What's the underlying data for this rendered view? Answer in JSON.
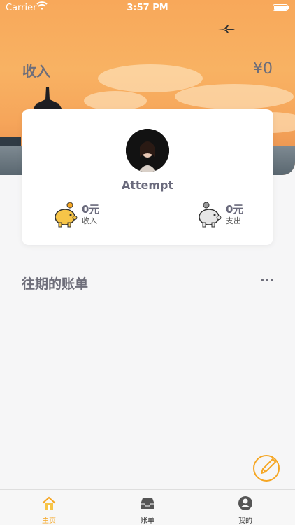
{
  "status_bar": {
    "carrier": "Carrier",
    "time": "3:57 PM"
  },
  "hero": {
    "income_label": "收入",
    "income_value": "¥0"
  },
  "profile": {
    "username": "Attempt"
  },
  "stats": [
    {
      "amount": "0元",
      "label": "收入",
      "icon": "piggy-bank-gold-icon"
    },
    {
      "amount": "0元",
      "label": "支出",
      "icon": "piggy-bank-gray-icon"
    }
  ],
  "history": {
    "title": "往期的账单"
  },
  "tabbar": {
    "items": [
      {
        "label": "主页",
        "icon": "home-icon",
        "active": true
      },
      {
        "label": "账单",
        "icon": "inbox-icon",
        "active": false
      },
      {
        "label": "我的",
        "icon": "user-icon",
        "active": false
      }
    ]
  },
  "colors": {
    "accent": "#f5a623",
    "text": "#6e6e7a"
  }
}
